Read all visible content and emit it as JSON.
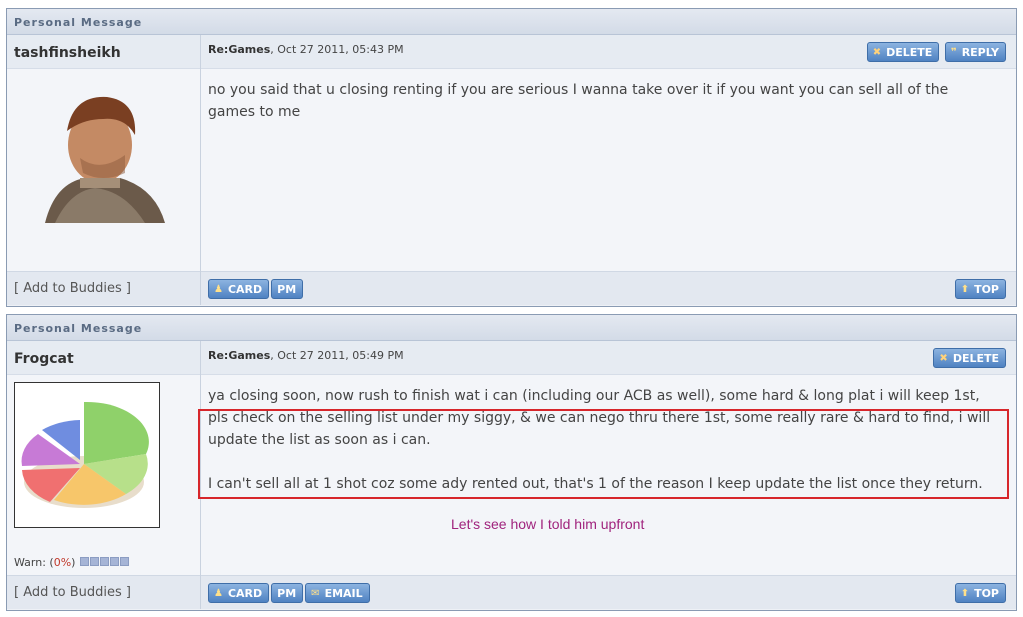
{
  "messages": [
    {
      "header": "Personal Message",
      "author": "tashfinsheikh",
      "subject": "Re:Games",
      "date": ", Oct 27 2011, 05:43 PM",
      "body": [
        "no you said that u closing renting if you are serious I wanna take over it if you want you can sell all of the",
        "games to me"
      ],
      "delete_label": "DELETE",
      "reply_label": "REPLY",
      "buddies_label": "[ Add to Buddies ]",
      "card_label": "CARD",
      "pm_label": "PM",
      "top_label": "TOP"
    },
    {
      "header": "Personal Message",
      "author": "Frogcat",
      "subject": "Re:Games",
      "date": ", Oct 27 2011, 05:49 PM",
      "body": [
        "ya closing soon, now rush to finish wat i can (including our ACB as well), some hard & long plat i will keep 1st,",
        "pls check on the selling list under my siggy, & we can nego thru there 1st, some really rare & hard to find, i will",
        "update the list as soon as i can.",
        "",
        "I can't sell all at 1 shot coz some ady rented out, that's 1 of the reason I keep update the list once they return."
      ],
      "delete_label": "DELETE",
      "warn_label": "Warn: (",
      "warn_pct": "0%",
      "warn_close": ")",
      "buddies_label": "[ Add to Buddies ]",
      "card_label": "CARD",
      "pm_label": "PM",
      "email_label": "EMAIL",
      "top_label": "TOP"
    }
  ],
  "annotation": "Let's see how I told him upfront",
  "colors": {
    "highlight": "#d7262b",
    "annotation": "#a0237d",
    "button": "#4f82c2"
  }
}
